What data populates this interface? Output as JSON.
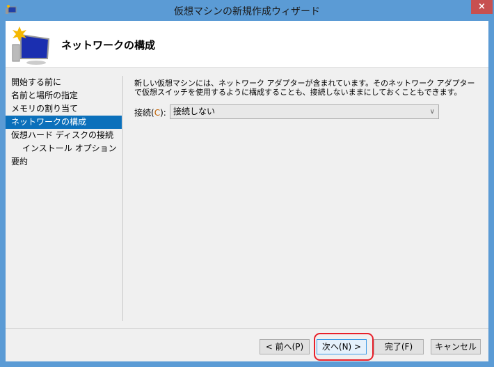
{
  "window": {
    "title": "仮想マシンの新規作成ウィザード",
    "close_label": "×"
  },
  "header": {
    "title": "ネットワークの構成"
  },
  "sidebar": {
    "items": [
      {
        "label": "開始する前に"
      },
      {
        "label": "名前と場所の指定"
      },
      {
        "label": "メモリの割り当て"
      },
      {
        "label": "ネットワークの構成",
        "selected": true
      },
      {
        "label": "仮想ハード ディスクの接続"
      },
      {
        "label": "インストール オプション"
      },
      {
        "label": "要約"
      }
    ]
  },
  "main": {
    "description": "新しい仮想マシンには、ネットワーク アダプターが含まれています。そのネットワーク アダプターで仮想スイッチを使用するように構成することも、接続しないままにしておくこともできます。",
    "connection_label": "接続(",
    "connection_accel": "C",
    "connection_label_end": "):",
    "connection_value": "接続しない"
  },
  "buttons": {
    "back": "< 前へ(P)",
    "next": "次へ(N) >",
    "finish": "完了(F)",
    "cancel": "キャンセル"
  },
  "colors": {
    "titlebar": "#5b9bd5",
    "selected": "#0b70bb",
    "highlight": "#e8202a"
  }
}
